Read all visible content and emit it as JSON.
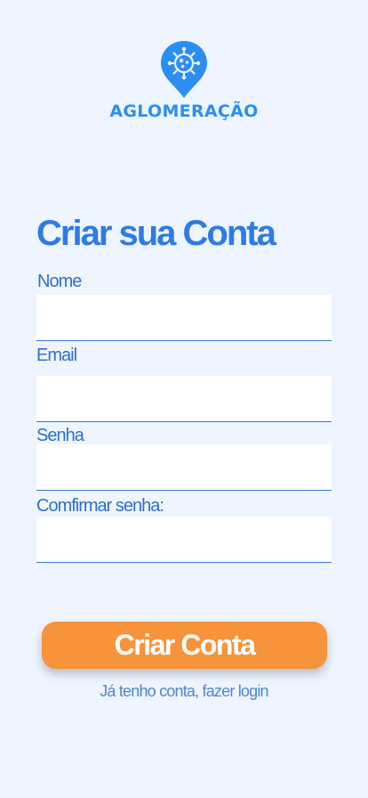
{
  "brand": {
    "name": "AGLOMERAÇÃO",
    "logo_icon": "virus-location-pin-icon",
    "color": "#2d8ef2"
  },
  "form": {
    "title": "Criar sua Conta",
    "fields": [
      {
        "label": "Nome",
        "value": ""
      },
      {
        "label": "Email",
        "value": ""
      },
      {
        "label": "Senha",
        "value": ""
      },
      {
        "label": "Comfirmar senha:",
        "value": ""
      }
    ],
    "submit_label": "Criar Conta",
    "login_link": "Já tenho conta, fazer login"
  },
  "colors": {
    "background": "#eef5ff",
    "title": "#2e7ae6",
    "accent_button": "#f7933a",
    "link": "#4c86d6"
  }
}
